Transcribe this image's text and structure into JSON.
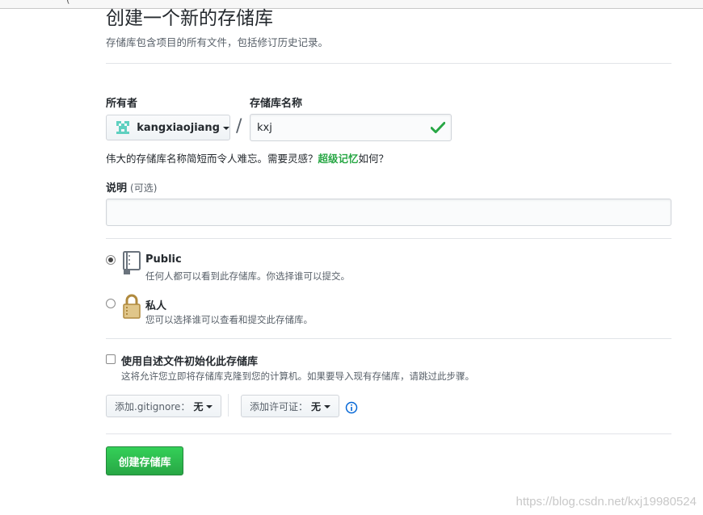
{
  "top_strip": {
    "text": "- ~ - ~ ~ ("
  },
  "header": {
    "title": "创建一个新的存储库",
    "subtitle": "存储库包含项目的所有文件，包括修订历史记录。"
  },
  "owner": {
    "label": "所有者",
    "value": "kangxiaojiang"
  },
  "repo_name": {
    "label": "存储库名称",
    "value": "kxj",
    "separator": "/"
  },
  "hint": {
    "prefix": "伟大的存储库名称简短而令人难忘。需要灵感？",
    "suggestion": "超级记忆",
    "suffix": "如何？"
  },
  "description": {
    "label": "说明",
    "optional": "(可选)",
    "value": ""
  },
  "visibility": {
    "public": {
      "title": "Public",
      "desc": "任何人都可以看到此存储库。你选择谁可以提交。",
      "selected": true
    },
    "private": {
      "title": "私人",
      "desc": "您可以选择谁可以查看和提交此存储库。",
      "selected": false
    }
  },
  "readme": {
    "label": "使用自述文件初始化此存储库",
    "desc": "这将允许您立即将存储库克隆到您的计算机。如果要导入现有存储库，请跳过此步骤。",
    "checked": false
  },
  "gitignore": {
    "label": "添加.gitignore：",
    "value": "无"
  },
  "license": {
    "label": "添加许可证：",
    "value": "无"
  },
  "create_button": "创建存储库",
  "watermark": "https://blog.csdn.net/kxj19980524",
  "colors": {
    "primary_green": "#28a745",
    "border": "#d1d5da",
    "text": "#24292e"
  }
}
